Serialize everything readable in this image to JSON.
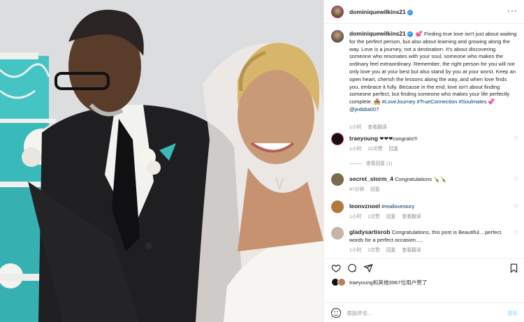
{
  "post": {
    "username": "dominiquewilkins21",
    "caption": "Finding true love isn't just about waiting for the perfect person, but also about learning and growing along the way. Love is a journey, not a destination. It's about discovering someone who resonates with your soul, someone who makes the ordinary feel extraordinary. Remember, the right person for you will not only love you at your best but also stand by you at your worst. Keep an open heart, cherish the lessons along the way, and when love finds you, embrace it fully. Because in the end, love isn't about finding someone perfect, but finding someone who makes your life perfectly complete.",
    "caption_prefix_emoji": "·💕",
    "caption_suffix_emoji": "💑",
    "hashtags": "#LoveJourney #TrueConnection #Soulmates",
    "hashtag_emoji": "💞",
    "mention": "@jedidia007",
    "caption_time": "1小时",
    "caption_translate": "查看翻译"
  },
  "comments": [
    {
      "username": "traeyoung",
      "text": "❤❤❤congrats!!!",
      "time": "1小时",
      "likes": "22次赞",
      "reply": "回复",
      "view_replies": "查看回复 (1)",
      "avatar_color": "#111111"
    },
    {
      "username": "secret_storm_4",
      "text": "Congratulations 🍾🍾",
      "time": "47分钟",
      "reply": "回复",
      "avatar_color": "#7a6a4f"
    },
    {
      "username": "leonvznoel",
      "text": "#reallovestory",
      "time": "1小时",
      "likes": "1次赞",
      "reply": "回复",
      "translate": "查看翻译",
      "avatar_color": "#b07a3a"
    },
    {
      "username": "gladysartisrob",
      "text": "Congratulations, this post is Beautiful....perfect words for a perfect occasion.....",
      "time": "1小时",
      "likes": "2次赞",
      "reply": "回复",
      "translate": "查看翻译",
      "avatar_color": "#c6b4a8"
    }
  ],
  "likes_text": "traeyoung和其他3967位用户赞了",
  "add_comment_placeholder": "添加评论...",
  "post_label": "发布",
  "colors": {
    "link": "#00376b",
    "verified": "#3897f0",
    "cake": "#3fbfbf",
    "text_secondary": "#8e8e8e"
  },
  "icons": [
    "heart-icon",
    "comment-icon",
    "share-icon",
    "bookmark-icon",
    "emoji-icon",
    "more-icon",
    "verified-icon"
  ]
}
